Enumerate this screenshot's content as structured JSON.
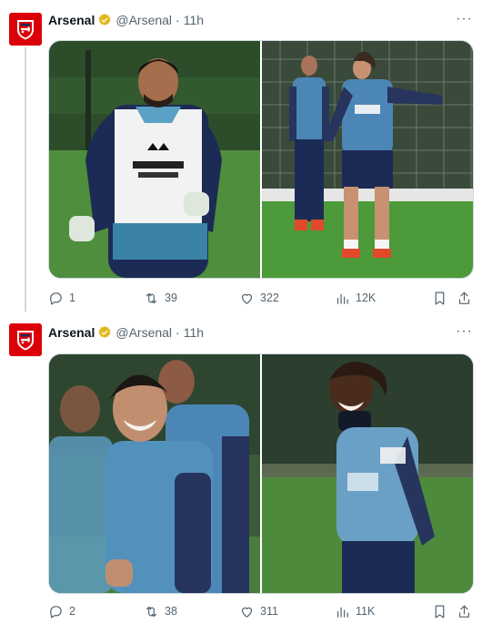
{
  "tweets": [
    {
      "name": "Arsenal",
      "handle": "@Arsenal",
      "separator": "·",
      "time": "11h",
      "replies": "1",
      "retweets": "39",
      "likes": "322",
      "views": "12K",
      "photos": [
        "training-photo-goalkeeper-bib",
        "training-photo-players-pitch"
      ]
    },
    {
      "name": "Arsenal",
      "handle": "@Arsenal",
      "separator": "·",
      "time": "11h",
      "replies": "2",
      "retweets": "38",
      "likes": "311",
      "views": "11K",
      "photos": [
        "training-photo-smiling-player",
        "training-photo-laughing-player"
      ]
    }
  ],
  "more_label": "···",
  "colors": {
    "brand_red": "#db0007",
    "verified_gold": "#e2b719",
    "muted": "#536471",
    "border": "#cfd9de"
  }
}
